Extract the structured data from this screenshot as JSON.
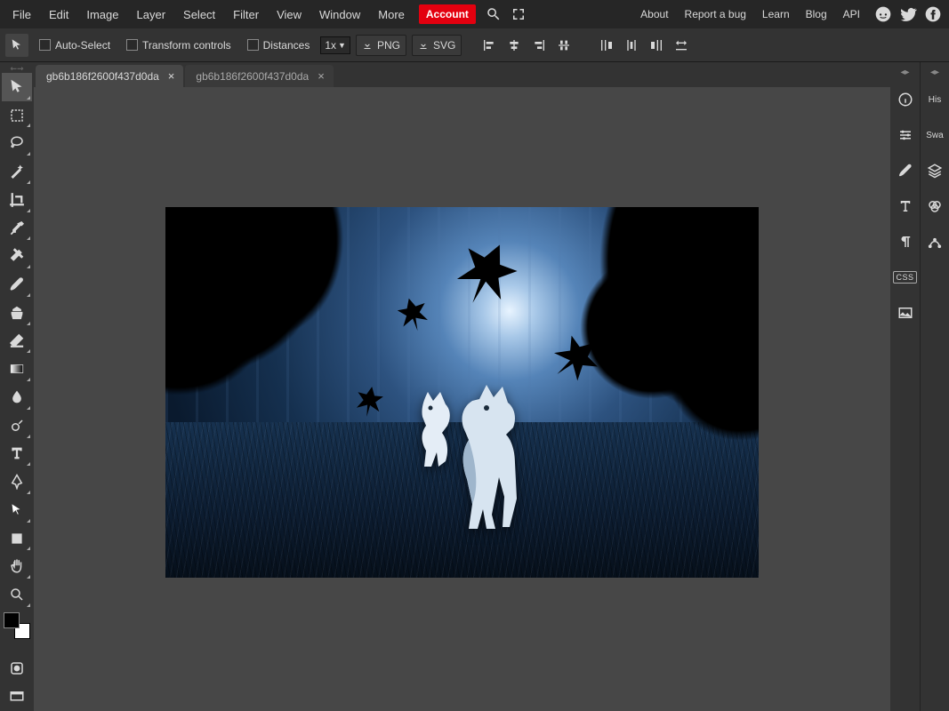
{
  "menu": {
    "items": [
      "File",
      "Edit",
      "Image",
      "Layer",
      "Select",
      "Filter",
      "View",
      "Window",
      "More"
    ],
    "account": "Account",
    "right_links": [
      "About",
      "Report a bug",
      "Learn",
      "Blog",
      "API"
    ]
  },
  "options": {
    "auto_select": "Auto-Select",
    "transform_controls": "Transform controls",
    "distances": "Distances",
    "zoom": "1x",
    "png": "PNG",
    "svg": "SVG"
  },
  "tabs": [
    {
      "label": "gb6b186f2600f437d0da",
      "active": true
    },
    {
      "label": "gb6b186f2600f437d0da",
      "active": false
    }
  ],
  "right_rail": {
    "css_label": "CSS"
  },
  "far_rail": {
    "history": "His",
    "swatches": "Swa"
  },
  "tools": [
    "move",
    "rect-select",
    "lasso",
    "wand",
    "crop",
    "eyedropper",
    "healing",
    "brush",
    "stamp",
    "eraser",
    "gradient",
    "blur",
    "dodge",
    "type",
    "pen",
    "path-select",
    "shape",
    "hand",
    "zoom"
  ]
}
